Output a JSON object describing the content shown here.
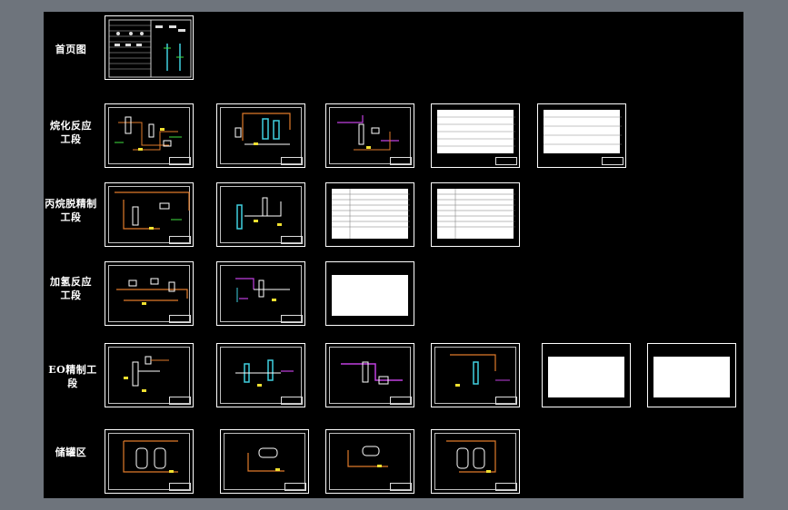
{
  "rows": [
    {
      "label": "首页图"
    },
    {
      "label": "烷化反应\n工段"
    },
    {
      "label": "丙烷脱精制\n工段"
    },
    {
      "label": "加氢反应\n工段"
    },
    {
      "label": "EO精制工段"
    },
    {
      "label": "储罐区"
    }
  ],
  "colors": {
    "background": "#6e747c",
    "canvas": "#000000",
    "line_white": "#ffffff",
    "line_orange": "#e07a2a",
    "line_magenta": "#c040e0",
    "line_yellow": "#f0e030",
    "line_cyan": "#40d0e0",
    "line_green": "#40e040"
  }
}
